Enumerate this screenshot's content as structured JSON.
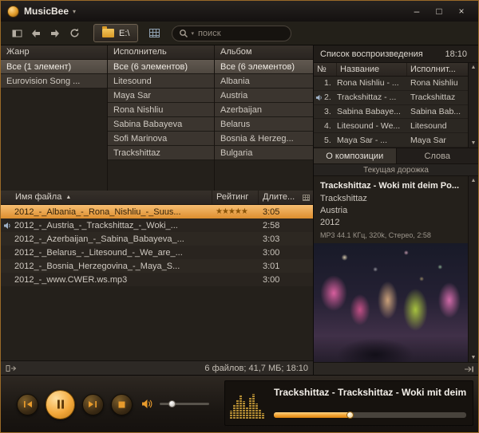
{
  "window": {
    "title": "MusicBee",
    "controls": {
      "minimize": "–",
      "maximize": "□",
      "close": "×"
    }
  },
  "icons": {
    "dropdown": "▾",
    "sort_asc": "▲",
    "scroll_up": "▲",
    "scroll_down": "▼"
  },
  "toolbar": {
    "drive_button": "E:\\",
    "search_placeholder": "поиск"
  },
  "browser": {
    "genre": {
      "header": "Жанр",
      "items": [
        "Все (1 элемент)",
        "Eurovision Song ..."
      ]
    },
    "artist": {
      "header": "Исполнитель",
      "items": [
        "Все (6 элементов)",
        "Litesound",
        "Maya Sar",
        "Rona Nishliu",
        "Sabina Babayeva",
        "Sofi Marinova",
        "Trackshittaz"
      ]
    },
    "album": {
      "header": "Альбом",
      "items": [
        "Все (6 элементов)",
        "Albania",
        "Austria",
        "Azerbaijan",
        "Belarus",
        "Bosnia & Herzeg...",
        "Bulgaria"
      ]
    }
  },
  "filelist": {
    "columns": {
      "name": "Имя файла",
      "rating": "Рейтинг",
      "duration": "Длите..."
    },
    "rows": [
      {
        "name": "2012_-_Albania_-_Rona_Nishliu_-_Suus...",
        "stars": "★★★★★",
        "duration": "3:05"
      },
      {
        "name": "2012_-_Austria_-_Trackshittaz_-_Woki_...",
        "stars": "",
        "duration": "2:58"
      },
      {
        "name": "2012_-_Azerbaijan_-_Sabina_Babayeva_...",
        "stars": "",
        "duration": "3:03"
      },
      {
        "name": "2012_-_Belarus_-_Litesound_-_We_are_...",
        "stars": "",
        "duration": "3:00"
      },
      {
        "name": "2012_-_Bosnia_Herzegovina_-_Maya_S...",
        "stars": "",
        "duration": "3:01"
      },
      {
        "name": "2012_-_www.CWER.ws.mp3",
        "stars": "",
        "duration": "3:00"
      }
    ],
    "status": "6 файлов; 41,7 МБ; 18:10"
  },
  "playlist": {
    "title": "Список воспроизведения",
    "total_time": "18:10",
    "columns": {
      "num": "№",
      "name": "Название",
      "artist": "Исполнит..."
    },
    "rows": [
      {
        "num": "1.",
        "name": "Rona Nishliu - ...",
        "artist": "Rona Nishliu"
      },
      {
        "num": "2.",
        "name": "Trackshittaz - ...",
        "artist": "Trackshittaz"
      },
      {
        "num": "3.",
        "name": "Sabina Babaye...",
        "artist": "Sabina Bab..."
      },
      {
        "num": "4.",
        "name": "Litesound - We...",
        "artist": "Litesound"
      },
      {
        "num": "5.",
        "name": "Maya Sar - ...",
        "artist": "Maya Sar"
      }
    ]
  },
  "track_panel": {
    "tabs": [
      "О композиции",
      "Слова"
    ],
    "section_title": "Текущая дорожка",
    "title": "Trackshittaz - Woki mit deim Po...",
    "artist": "Trackshittaz",
    "album": "Austria",
    "year": "2012",
    "format": "MP3 44.1 КГц, 320k, Стерео, 2:58"
  },
  "player": {
    "now_playing": "Trackshittaz - Trackshittaz - Woki mit deim Po",
    "progress_percent": 40
  }
}
